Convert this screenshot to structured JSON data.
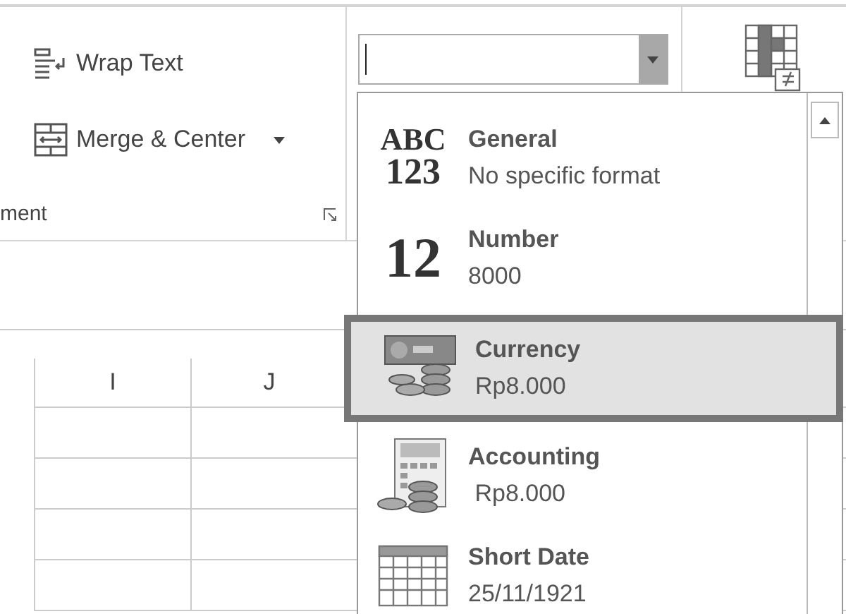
{
  "ribbon": {
    "alignment_group": {
      "buttons": [
        {
          "kind": "wrap",
          "label": "Wrap Text",
          "has_menu": false
        },
        {
          "kind": "merge",
          "label": "Merge & Center",
          "has_menu": true
        }
      ],
      "group_label": "ment"
    }
  },
  "sheet": {
    "column_headers": [
      "I",
      "J"
    ]
  },
  "number_format": {
    "formats": [
      {
        "name": "General",
        "example": "No specific format",
        "selected": false,
        "icon": {
          "kind": "text",
          "lines": [
            "ABC",
            "123"
          ]
        }
      },
      {
        "name": "Number",
        "example": "8000",
        "selected": false,
        "icon": {
          "kind": "text",
          "lines": [
            "12"
          ]
        }
      },
      {
        "name": "Currency",
        "example": "Rp8.000",
        "selected": true,
        "icon": {
          "kind": "currency"
        }
      },
      {
        "name": "Accounting",
        "example": " Rp8.000",
        "selected": false,
        "icon": {
          "kind": "accounting"
        }
      },
      {
        "name": "Short Date",
        "example": "25/11/1921",
        "selected": false,
        "icon": {
          "kind": "calendar"
        }
      }
    ]
  }
}
